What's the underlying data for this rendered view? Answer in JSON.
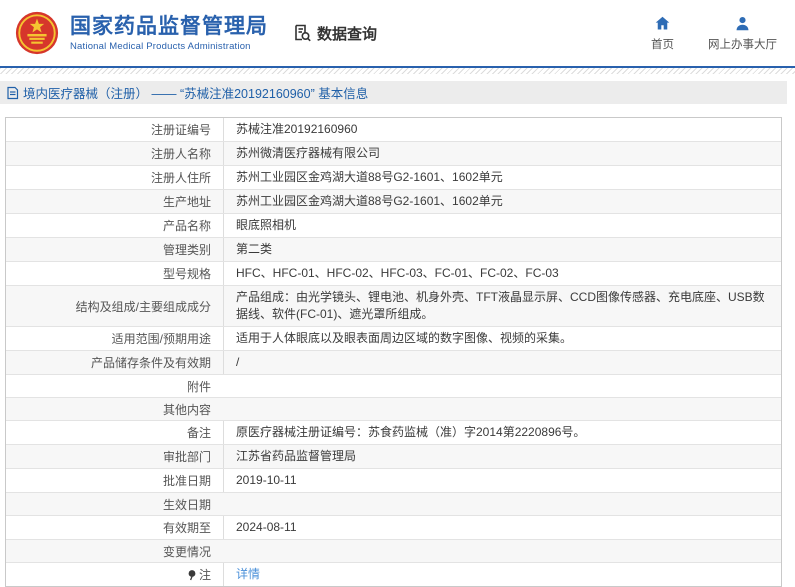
{
  "header": {
    "agency_name": "国家药品监督管理局",
    "agency_name_en": "National Medical Products Administration",
    "section_title": "数据查询",
    "nav": [
      {
        "label": "首页",
        "icon": "home-icon"
      },
      {
        "label": "网上办事大厅",
        "icon": "user-icon"
      }
    ]
  },
  "breadcrumb": {
    "text": "境内医疗器械（注册） —— “苏械注准20192160960” 基本信息"
  },
  "table": {
    "rows": [
      {
        "label": "注册证编号",
        "value": "苏械注准20192160960"
      },
      {
        "label": "注册人名称",
        "value": "苏州微清医疗器械有限公司"
      },
      {
        "label": "注册人住所",
        "value": "苏州工业园区金鸡湖大道88号G2-1601、1602单元"
      },
      {
        "label": "生产地址",
        "value": "苏州工业园区金鸡湖大道88号G2-1601、1602单元"
      },
      {
        "label": "产品名称",
        "value": "眼底照相机"
      },
      {
        "label": "管理类别",
        "value": "第二类"
      },
      {
        "label": "型号规格",
        "value": "HFC、HFC-01、HFC-02、HFC-03、FC-01、FC-02、FC-03"
      },
      {
        "label": "结构及组成/主要组成成分",
        "value": "产品组成：由光学镜头、锂电池、机身外壳、TFT液晶显示屏、CCD图像传感器、充电底座、USB数据线、软件(FC-01)、遮光罩所组成。"
      },
      {
        "label": "适用范围/预期用途",
        "value": "适用于人体眼底以及眼表面周边区域的数字图像、视频的采集。"
      },
      {
        "label": "产品储存条件及有效期",
        "value": "/"
      },
      {
        "label": "附件",
        "value": ""
      },
      {
        "label": "其他内容",
        "value": ""
      },
      {
        "label": "备注",
        "value": "原医疗器械注册证编号：苏食药监械（准）字2014第2220896号。"
      },
      {
        "label": "审批部门",
        "value": "江苏省药品监督管理局"
      },
      {
        "label": "批准日期",
        "value": "2019-10-11"
      },
      {
        "label": "生效日期",
        "value": ""
      },
      {
        "label": "有效期至",
        "value": "2024-08-11"
      },
      {
        "label": "变更情况",
        "value": ""
      },
      {
        "label": "注",
        "value": "详情",
        "value_type": "link",
        "label_icon": "note-pin-icon"
      }
    ]
  },
  "colors": {
    "brand_blue": "#2961ad",
    "link_blue": "#4a90d9",
    "emblem_red": "#d6362b",
    "emblem_gold": "#f5c431",
    "breadcrumb_bg": "#ececec",
    "row_alt_bg": "#f7f7f7"
  }
}
